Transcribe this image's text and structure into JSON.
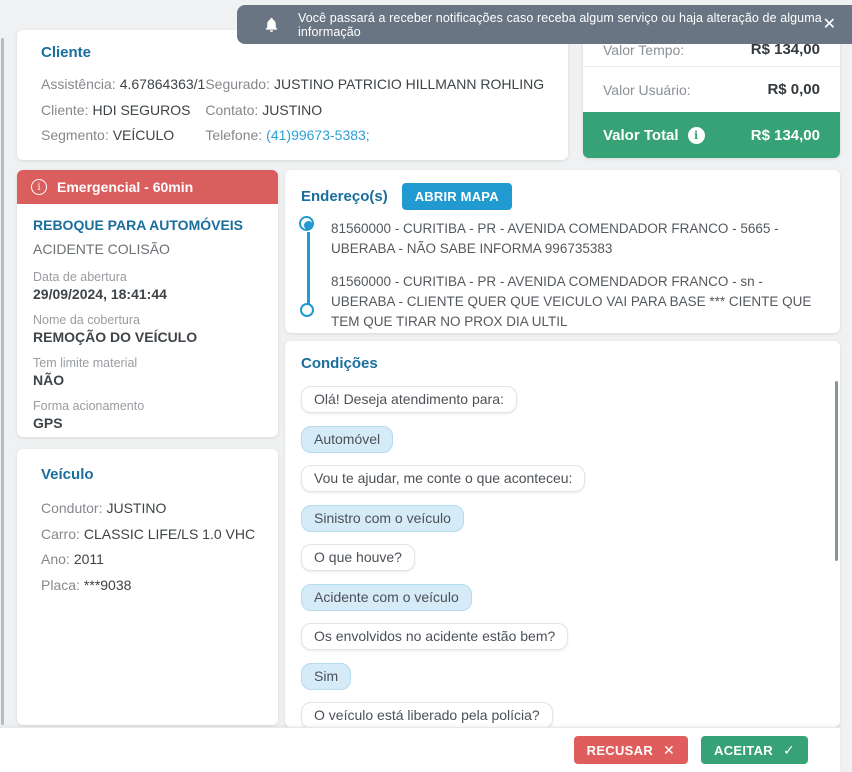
{
  "notification": {
    "text": "Você passará a receber notificações caso receba algum serviço ou haja alteração de alguma informação",
    "close_icon": "✕"
  },
  "icons": {
    "info": "i"
  },
  "cliente": {
    "title": "Cliente",
    "col1": [
      {
        "label": "Assistência:",
        "value": "4.67864363/1"
      },
      {
        "label": "Cliente:",
        "value": "HDI SEGUROS"
      },
      {
        "label": "Segmento:",
        "value": "VEÍCULO"
      }
    ],
    "col2": [
      {
        "label": "Segurado:",
        "value": "JUSTINO PATRICIO HILLMANN ROHLING"
      },
      {
        "label": "Contato:",
        "value": "JUSTINO"
      },
      {
        "label": "Telefone:",
        "value": "(41)99673-5383;"
      }
    ]
  },
  "valores": {
    "rows": [
      {
        "label": "Valor Tempo:",
        "value": "R$ 134,00"
      },
      {
        "label": "Valor Usuário:",
        "value": "R$ 0,00"
      }
    ],
    "total": {
      "label": "Valor Total",
      "value": "R$ 134,00"
    }
  },
  "servico": {
    "banner": "Emergencial - 60min",
    "title": "REBOQUE PARA AUTOMÓVEIS",
    "subtitle": "ACIDENTE COLISÃO",
    "details": [
      {
        "label": "Data de abertura",
        "value": "29/09/2024, 18:41:44"
      },
      {
        "label": "Nome da cobertura",
        "value": "REMOÇÃO DO VEÍCULO"
      },
      {
        "label": "Tem limite material",
        "value": "NÃO"
      },
      {
        "label": "Forma acionamento",
        "value": "GPS"
      }
    ]
  },
  "veiculo": {
    "title": "Veículo",
    "fields": [
      {
        "label": "Condutor:",
        "value": "JUSTINO"
      },
      {
        "label": "Carro:",
        "value": "CLASSIC LIFE/LS 1.0 VHC"
      },
      {
        "label": "Ano:",
        "value": "2011"
      },
      {
        "label": "Placa:",
        "value": "***9038"
      }
    ]
  },
  "enderecos": {
    "title": "Endereço(s)",
    "map_button": "ABRIR MAPA",
    "items": [
      "81560000 - CURITIBA - PR - AVENIDA COMENDADOR FRANCO - 5665 - UBERABA - NÃO SABE INFORMA 996735383",
      "81560000 - CURITIBA - PR - AVENIDA COMENDADOR FRANCO - sn - UBERABA - CLIENTE QUER QUE VEICULO VAI PARA BASE *** CIENTE QUE TEM QUE TIRAR NO PROX DIA ULTIL"
    ]
  },
  "condicoes": {
    "title": "Condições",
    "messages": [
      {
        "text": "Olá! Deseja atendimento para:",
        "type": "question"
      },
      {
        "text": "Automóvel",
        "type": "answer"
      },
      {
        "text": "Vou te ajudar, me conte o que aconteceu:",
        "type": "question"
      },
      {
        "text": "Sinistro com o veículo",
        "type": "answer"
      },
      {
        "text": "O que houve?",
        "type": "question"
      },
      {
        "text": "Acidente com o veículo",
        "type": "answer"
      },
      {
        "text": "Os envolvidos no acidente estão bem?",
        "type": "question"
      },
      {
        "text": "Sim",
        "type": "answer"
      },
      {
        "text": "O veículo está liberado pela polícia?",
        "type": "question"
      }
    ]
  },
  "actions": {
    "recusar": "RECUSAR",
    "recusar_icon": "✕",
    "aceitar": "ACEITAR",
    "aceitar_icon": "✓"
  },
  "colors": {
    "accent_blue": "#2199d1",
    "title_blue": "#1a6e9c",
    "danger_red": "#db5e5e",
    "success_green": "#36a275",
    "notification_gray": "#6a7583",
    "background": "#eff1f2"
  }
}
